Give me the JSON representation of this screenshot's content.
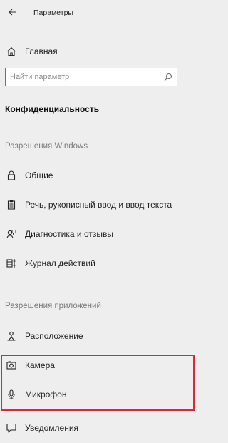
{
  "window": {
    "title": "Параметры"
  },
  "nav": {
    "home_label": "Главная"
  },
  "search": {
    "placeholder": "Найти параметр"
  },
  "section": {
    "title": "Конфиденциальность"
  },
  "groups": {
    "windows_permissions": "Разрешения Windows",
    "app_permissions": "Разрешения приложений"
  },
  "items": {
    "general": "Общие",
    "speech": "Речь, рукописный ввод и ввод текста",
    "diagnostics": "Диагностика и отзывы",
    "activity": "Журнал действий",
    "location": "Расположение",
    "camera": "Камера",
    "microphone": "Микрофон",
    "notifications": "Уведомления"
  },
  "colors": {
    "background": "#eeeeee",
    "search_border": "#1e88c8",
    "highlight": "#d9283a"
  },
  "icons": {
    "back": "arrow-left-icon",
    "home": "home-icon",
    "search": "search-icon",
    "general": "lock-icon",
    "speech": "clipboard-icon",
    "diagnostics": "person-feedback-icon",
    "activity": "timeline-icon",
    "location": "person-location-icon",
    "camera": "camera-icon",
    "microphone": "microphone-icon",
    "notifications": "message-icon"
  }
}
